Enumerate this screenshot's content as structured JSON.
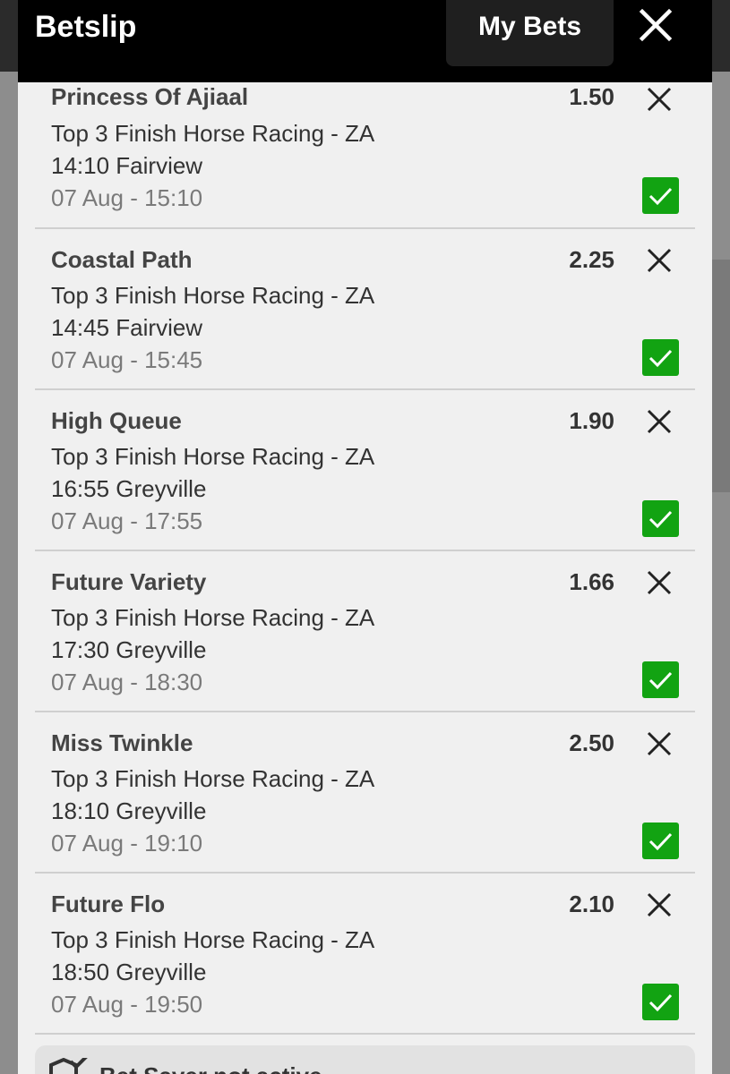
{
  "header": {
    "title": "Betslip",
    "my_bets_label": "My Bets"
  },
  "bets": [
    {
      "selection": "Princess Of Ajiaal",
      "odds": "1.50",
      "market": "Top 3 Finish Horse Racing - ZA",
      "event": "14:10 Fairview",
      "datetime": "07 Aug - 15:10",
      "checked": true
    },
    {
      "selection": "Coastal Path",
      "odds": "2.25",
      "market": "Top 3 Finish Horse Racing - ZA",
      "event": "14:45 Fairview",
      "datetime": "07 Aug - 15:45",
      "checked": true
    },
    {
      "selection": "High Queue",
      "odds": "1.90",
      "market": "Top 3 Finish Horse Racing - ZA",
      "event": "16:55 Greyville",
      "datetime": "07 Aug - 17:55",
      "checked": true
    },
    {
      "selection": "Future Variety",
      "odds": "1.66",
      "market": "Top 3 Finish Horse Racing - ZA",
      "event": "17:30 Greyville",
      "datetime": "07 Aug - 18:30",
      "checked": true
    },
    {
      "selection": "Miss Twinkle",
      "odds": "2.50",
      "market": "Top 3 Finish Horse Racing - ZA",
      "event": "18:10 Greyville",
      "datetime": "07 Aug - 19:10",
      "checked": true
    },
    {
      "selection": "Future Flo",
      "odds": "2.10",
      "market": "Top 3 Finish Horse Racing - ZA",
      "event": "18:50 Greyville",
      "datetime": "07 Aug - 19:50",
      "checked": true
    }
  ],
  "bet_saver": {
    "label": "Bet Saver not active"
  },
  "icons": {
    "close": "close-icon",
    "remove": "remove-icon",
    "check": "checkmark-icon",
    "bet_saver": "shield-icon"
  },
  "colors": {
    "header_bg": "#000000",
    "check_green": "#12a312",
    "sheet_bg": "#f0f0f0"
  }
}
